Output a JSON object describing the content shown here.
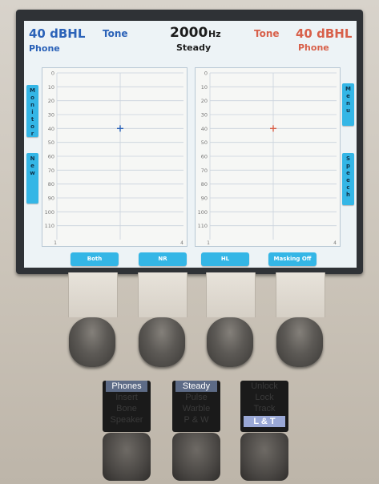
{
  "header": {
    "left_level": "40 dBHL",
    "left_mode": "Tone",
    "left_transducer": "Phone",
    "frequency": "2000",
    "frequency_unit": "Hz",
    "stimulus": "Steady",
    "right_mode": "Tone",
    "right_level": "40 dBHL",
    "right_transducer": "Phone"
  },
  "side_tabs": {
    "monitor": "M\no\nn\ni\nt\no\nr",
    "new": "N\ne\nw",
    "menu": "M\ne\nn\nu",
    "speech": "S\np\ne\ne\nc\nh"
  },
  "bottom_tabs": [
    "Both",
    "NR",
    "HL",
    "Masking Off"
  ],
  "chart_data": [
    {
      "type": "scatter",
      "y_ticks": [
        "0",
        "10",
        "20",
        "30",
        "40",
        "50",
        "60",
        "70",
        "80",
        "90",
        "100",
        "110"
      ],
      "x_ticks": [
        "1",
        "4"
      ],
      "ylim": [
        0,
        120
      ],
      "y_direction": "down",
      "grid": true,
      "points": [
        {
          "x": 2000,
          "y": 40,
          "marker": "+",
          "color": "#2b62b8"
        }
      ]
    },
    {
      "type": "scatter",
      "y_ticks": [
        "0",
        "10",
        "20",
        "30",
        "40",
        "50",
        "60",
        "70",
        "80",
        "90",
        "100",
        "110"
      ],
      "x_ticks": [
        "1",
        "4"
      ],
      "ylim": [
        0,
        120
      ],
      "y_direction": "down",
      "grid": true,
      "points": [
        {
          "x": 2000,
          "y": 40,
          "marker": "+",
          "color": "#d8604a"
        }
      ]
    }
  ],
  "button_labels": {
    "left": [
      "Phones",
      "Insert",
      "Bone",
      "Speaker"
    ],
    "middle": [
      "Steady",
      "Pulse",
      "Warble",
      "P & W"
    ],
    "right": [
      "Unlock",
      "Lock",
      "Track",
      "L & T"
    ]
  }
}
